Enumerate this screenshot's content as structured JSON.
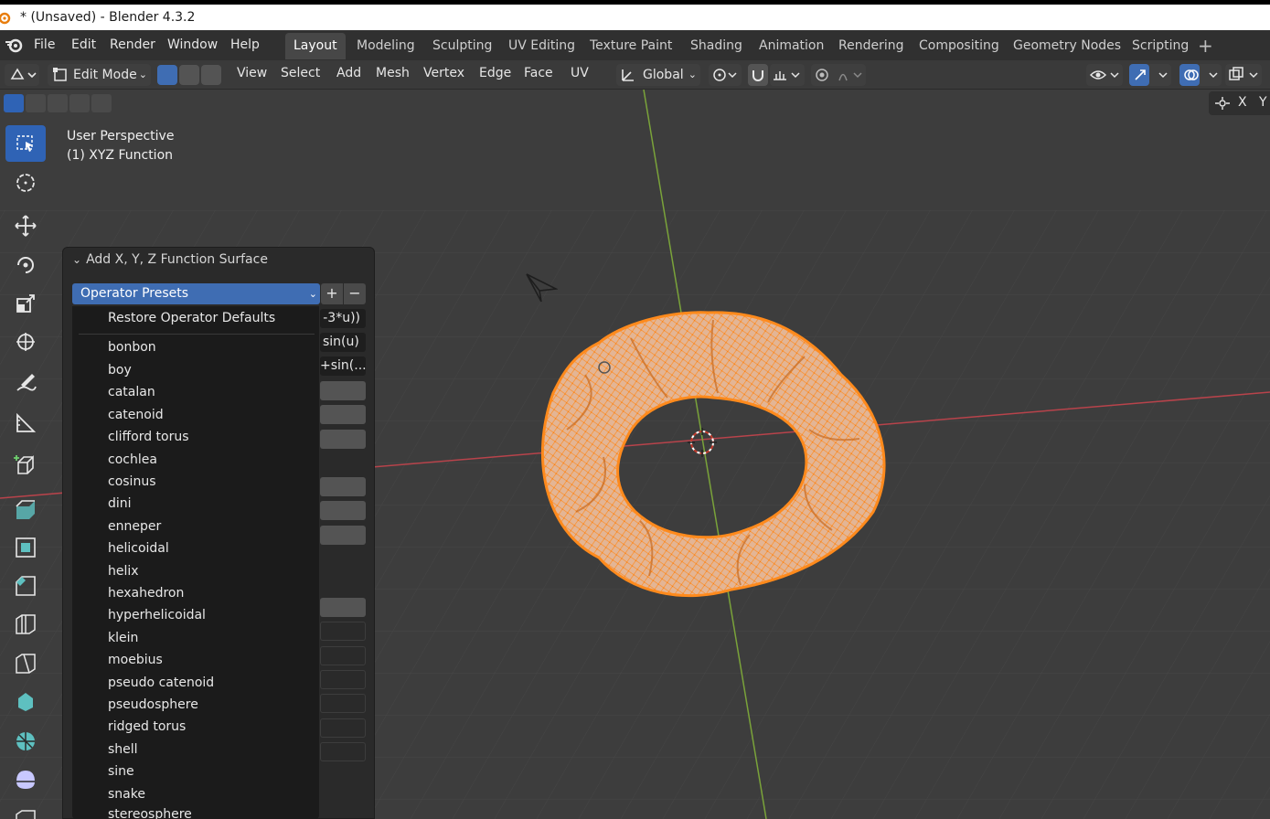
{
  "window": {
    "title": "* (Unsaved) - Blender 4.3.2"
  },
  "menu_bar": [
    "File",
    "Edit",
    "Render",
    "Window",
    "Help"
  ],
  "workspaces": [
    "Layout",
    "Modeling",
    "Sculpting",
    "UV Editing",
    "Texture Paint",
    "Shading",
    "Animation",
    "Rendering",
    "Compositing",
    "Geometry Nodes",
    "Scripting"
  ],
  "active_workspace": "Layout",
  "add_workspace": "+",
  "header": {
    "mode": "Edit Mode",
    "menus": [
      "View",
      "Select",
      "Add",
      "Mesh",
      "Vertex",
      "Edge",
      "Face",
      "UV"
    ],
    "orientation": "Global"
  },
  "gizmo_axes": [
    "X",
    "Y"
  ],
  "viewport_info": {
    "perspective": "User Perspective",
    "object": "(1) XYZ Function"
  },
  "operator_panel": {
    "title": "Add X, Y, Z Function Surface",
    "preset_label": "Operator Presets",
    "add": "+",
    "remove": "−",
    "visible_fields": [
      "-3*u))",
      "sin(u)",
      "+sin(..."
    ]
  },
  "preset_menu": {
    "default_item": "Restore Operator Defaults",
    "items": [
      "bonbon",
      "boy",
      "catalan",
      "catenoid",
      "clifford torus",
      "cochlea",
      "cosinus",
      "dini",
      "enneper",
      "helicoidal",
      "helix",
      "hexahedron",
      "hyperhelicoidal",
      "klein",
      "moebius",
      "pseudo catenoid",
      "pseudosphere",
      "ridged torus",
      "shell",
      "sine",
      "snake",
      "stereosphere"
    ]
  },
  "colors": {
    "accent_blue": "#3f6db3",
    "mesh_orange": "#ff8a1c",
    "axis_red": "#b8434b",
    "axis_green": "#7aa33a"
  }
}
